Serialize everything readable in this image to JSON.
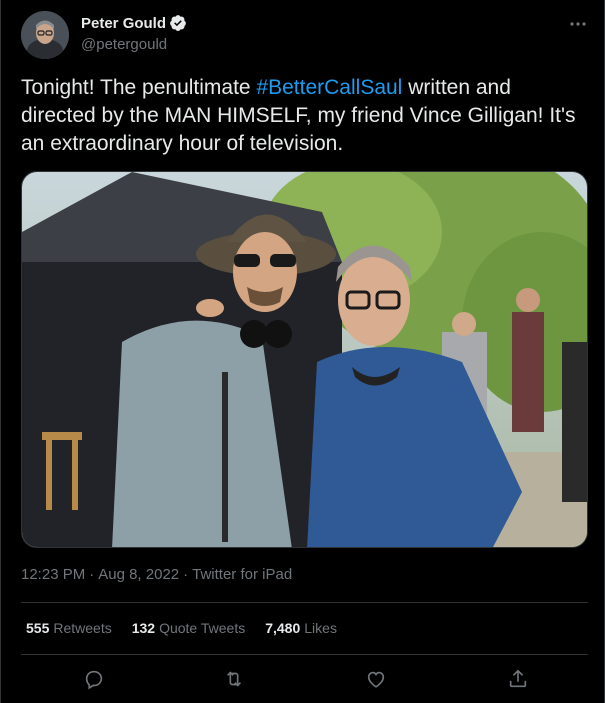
{
  "author": {
    "display_name": "Peter Gould",
    "handle": "@petergould",
    "verified": true,
    "avatar": "profile-photo"
  },
  "tweet": {
    "text_before": "Tonight!  The penultimate ",
    "hashtag": "#BetterCallSaul",
    "text_after": " written and directed by the MAN HIMSELF, my friend Vince Gilligan! It's an extraordinary hour of television.",
    "photo": "photo-two-men-on-set"
  },
  "meta": {
    "time": "12:23 PM",
    "separator": "·",
    "date": "Aug 8, 2022",
    "source": "Twitter for iPad"
  },
  "stats": {
    "retweets_count": "555",
    "retweets_label": "Retweets",
    "quotes_count": "132",
    "quotes_label": "Quote Tweets",
    "likes_count": "7,480",
    "likes_label": "Likes"
  },
  "icons": {
    "more": "more-horizontal-icon",
    "reply": "reply-icon",
    "retweet": "retweet-icon",
    "like": "heart-icon",
    "share": "share-icon",
    "verified": "verified-badge-icon"
  },
  "colors": {
    "background": "#000000",
    "text": "#e7e9ea",
    "secondary": "#71767b",
    "accent": "#1d9bf0",
    "divider": "#2f3336"
  }
}
